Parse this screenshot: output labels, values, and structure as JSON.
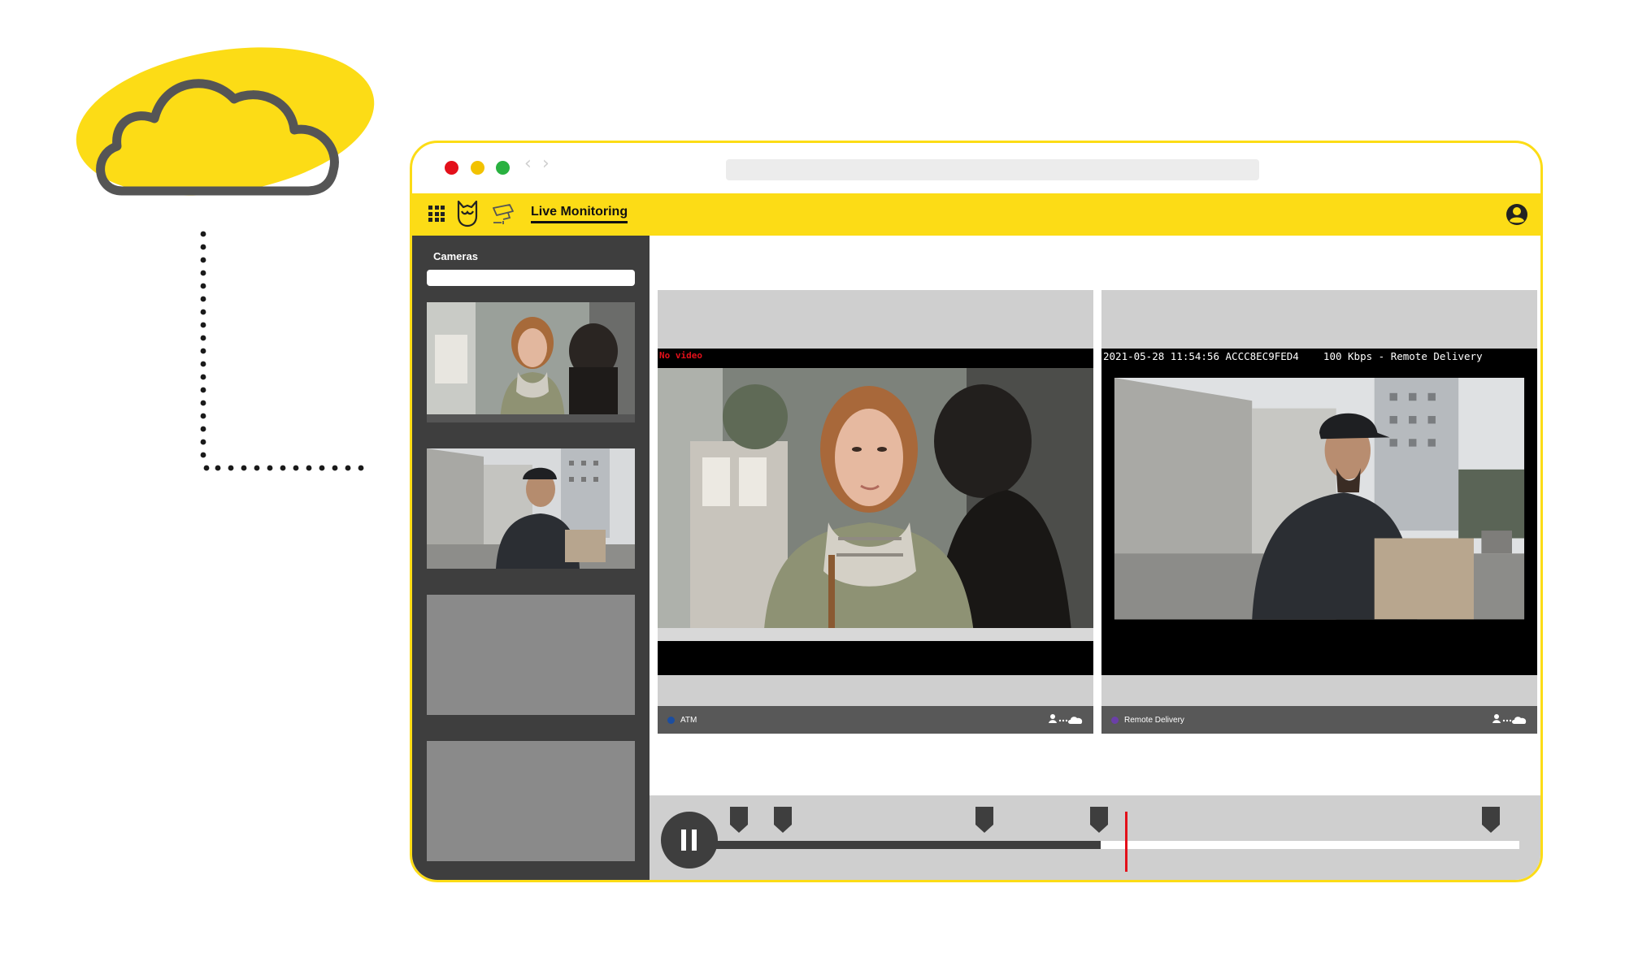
{
  "app": {
    "title": "Live Monitoring"
  },
  "sidebar": {
    "heading": "Cameras",
    "search_value": ""
  },
  "tiles": [
    {
      "label": "ATM",
      "overlay": "No video",
      "status_color": "#1C4EA0"
    },
    {
      "label": "Remote Delivery",
      "overlay": "2021-05-28 11:54:56 ACCC8EC9FED4    100 Kbps - Remote Delivery",
      "status_color": "#6B3FA8"
    }
  ],
  "timeline": {
    "state": "playing",
    "progress": 0.48,
    "playhead": 0.51,
    "markers": [
      0.03,
      0.085,
      0.335,
      0.478,
      0.965
    ]
  },
  "colors": {
    "brand_yellow": "#FCDC16",
    "dark_panel": "#3E3E3E",
    "alert_red": "#E3101A",
    "traffic_red": "#E3101A",
    "traffic_yellow": "#F2C200",
    "traffic_green": "#29B140"
  },
  "icons": {
    "apps": "grid-icon",
    "brand": "owl-logo-icon",
    "camera": "security-camera-icon",
    "user": "user-account-icon",
    "pause": "pause-icon",
    "marker": "bookmark-icon"
  }
}
